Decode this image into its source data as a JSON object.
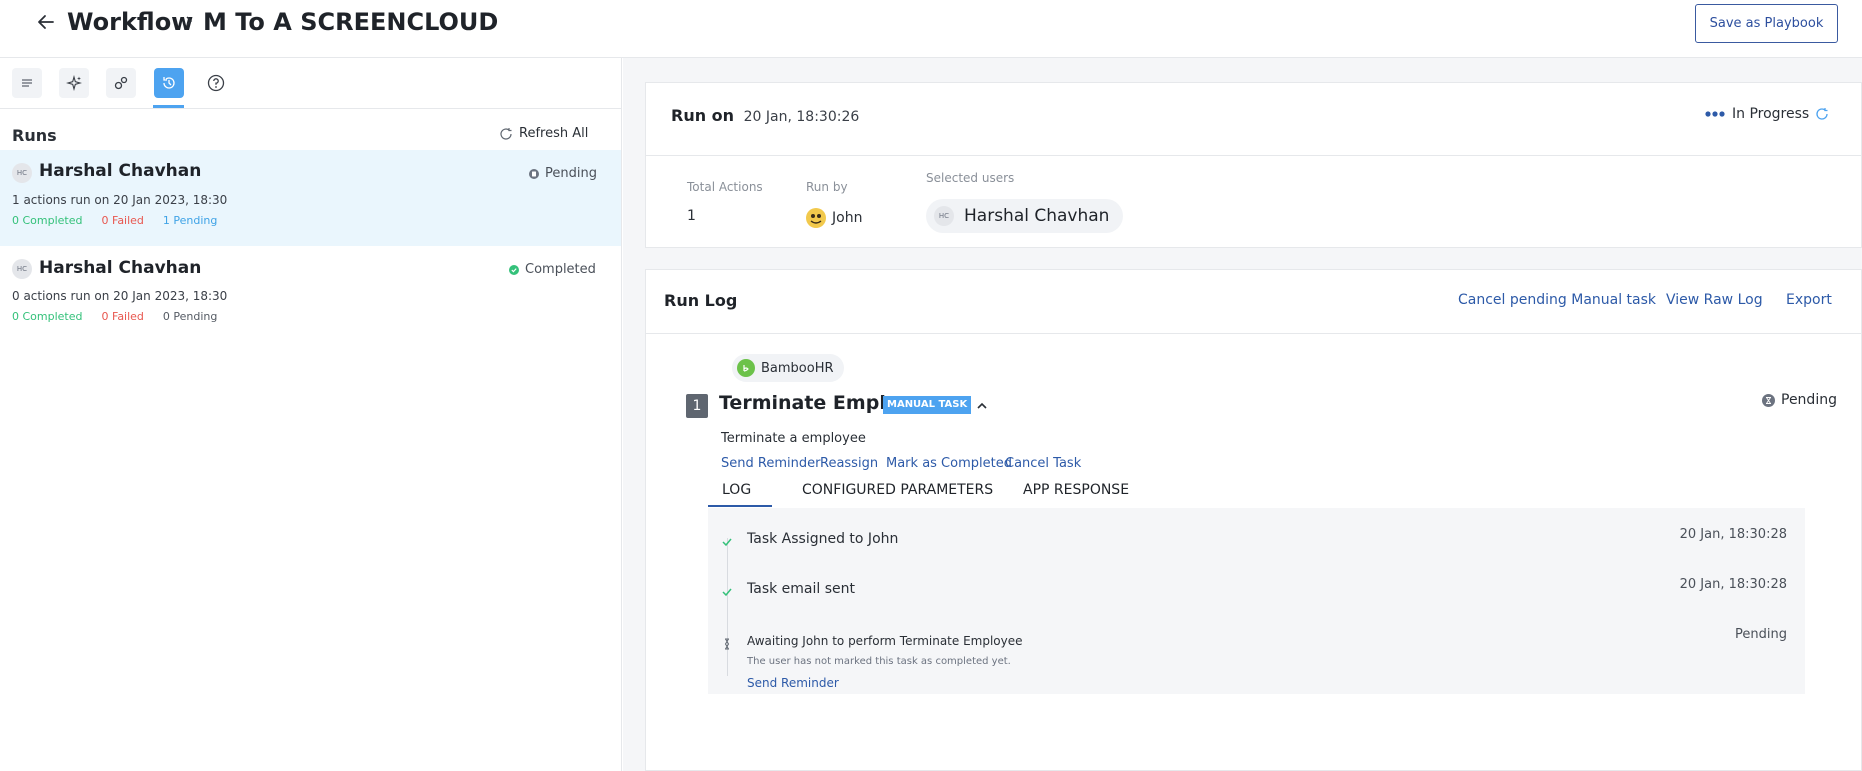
{
  "header": {
    "breadcrumb_root": "Workflow",
    "title": "M To A SCREENCLOUD",
    "save_button": "Save as Playbook"
  },
  "sidebar": {
    "runs_title": "Runs",
    "refresh_label": "Refresh All",
    "runs": [
      {
        "initials": "HC",
        "name": "Harshal Chavhan",
        "status": "Pending",
        "summary": "1 actions run on 20 Jan 2023, 18:30",
        "completed": "0 Completed",
        "failed": "0 Failed",
        "pending": "1 Pending"
      },
      {
        "initials": "HC",
        "name": "Harshal Chavhan",
        "status": "Completed",
        "summary": "0 actions run on 20 Jan 2023, 18:30",
        "completed": "0 Completed",
        "failed": "0 Failed",
        "pending": "0 Pending"
      }
    ]
  },
  "run_details": {
    "run_on_label": "Run on",
    "run_on_time": "20 Jan, 18:30:26",
    "status": "In Progress",
    "total_actions_label": "Total Actions",
    "total_actions_value": "1",
    "run_by_label": "Run by",
    "run_by_value": "John",
    "selected_users_label": "Selected users",
    "selected_user_initials": "HC",
    "selected_user_name": "Harshal Chavhan"
  },
  "run_log": {
    "title": "Run Log",
    "cancel_link": "Cancel pending Manual task",
    "raw_log_link": "View Raw Log",
    "export_link": "Export",
    "app_name": "BambooHR",
    "step_number": "1",
    "step_title": "Terminate Employee",
    "badge": "MANUAL TASK",
    "step_status": "Pending",
    "step_description": "Terminate a employee",
    "actions": [
      "Send Reminder",
      "Reassign",
      "Mark as Completed",
      "Cancel Task"
    ],
    "tabs": [
      "LOG",
      "CONFIGURED PARAMETERS",
      "APP RESPONSE"
    ],
    "entries": [
      {
        "text": "Task Assigned to John",
        "time": "20 Jan, 18:30:28"
      },
      {
        "text": "Task email sent",
        "time": "20 Jan, 18:30:28"
      },
      {
        "text": "Awaiting John to perform Terminate Employee",
        "time": "Pending",
        "sub": "The user has not marked this task as completed yet.",
        "link": "Send Reminder"
      }
    ]
  },
  "colors": {
    "accent": "#4da3f0",
    "link": "#2d5aa8",
    "success": "#34c17a",
    "danger": "#e8574f",
    "selected_row": "#eaf6fd"
  }
}
